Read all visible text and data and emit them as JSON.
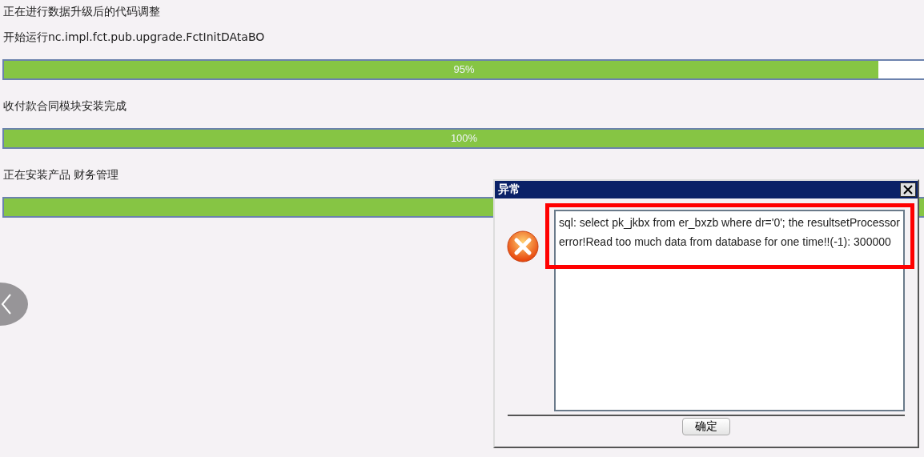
{
  "steps": [
    {
      "heading": "正在进行数据升级后的代码调整"
    },
    {
      "label": "开始运行nc.impl.fct.pub.upgrade.FctInitDAtaBO",
      "level": 0.95,
      "reading": "95%"
    },
    {
      "label": "收付款合同模块安装完成",
      "level": 1,
      "reading": "100%"
    },
    {
      "label": "正在安装产品 财务管理",
      "level": 1
    }
  ],
  "dialog": {
    "title": "异常",
    "message": "sql: select pk_jkbx from er_bxzb where  dr='0';   the resultsetProcessor error!Read too much data from database for one time!!(-1): 300000",
    "button": "确定"
  }
}
